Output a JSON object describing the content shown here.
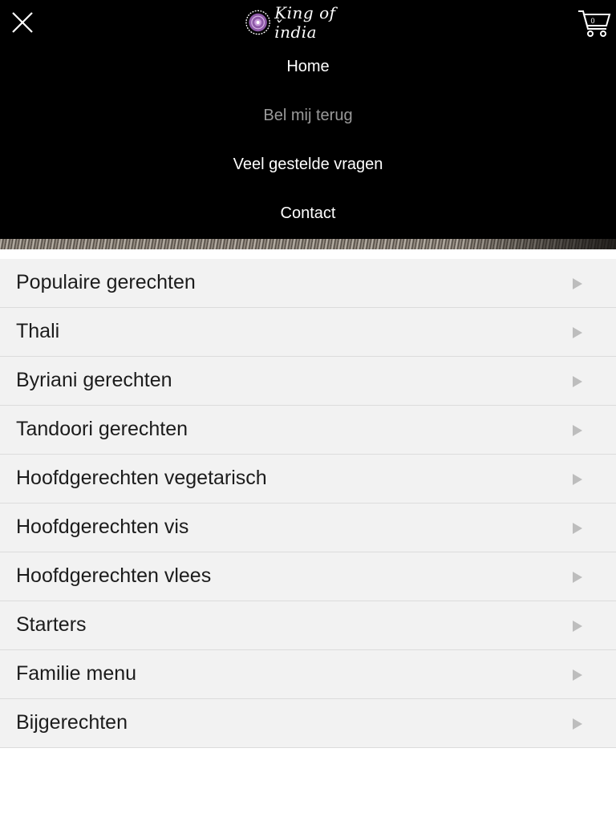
{
  "header": {
    "logo_text": "King of India",
    "close_icon": "close-icon",
    "cart_icon": "shopping-cart-icon",
    "cart_count": "0"
  },
  "nav": {
    "items": [
      {
        "label": "Home",
        "state": "active"
      },
      {
        "label": "Bel mij terug",
        "state": "muted"
      },
      {
        "label": "Veel gestelde vragen",
        "state": "active"
      },
      {
        "label": "Contact",
        "state": "active"
      }
    ]
  },
  "menu": {
    "categories": [
      {
        "label": "Populaire gerechten"
      },
      {
        "label": "Thali"
      },
      {
        "label": "Byriani gerechten"
      },
      {
        "label": "Tandoori gerechten"
      },
      {
        "label": "Hoofdgerechten vegetarisch"
      },
      {
        "label": "Hoofdgerechten vis"
      },
      {
        "label": "Hoofdgerechten vlees"
      },
      {
        "label": "Starters"
      },
      {
        "label": "Familie menu"
      },
      {
        "label": "Bijgerechten"
      }
    ],
    "arrow_icon": "triangle-right-icon"
  },
  "colors": {
    "overlay_bg": "#000000",
    "nav_active": "#ffffff",
    "nav_muted": "#9a9a9a",
    "logo_accent": "#8e5aa8",
    "row_bg": "#f2f2f2",
    "row_border": "#dcdcdc",
    "arrow": "#bdbdbd"
  }
}
